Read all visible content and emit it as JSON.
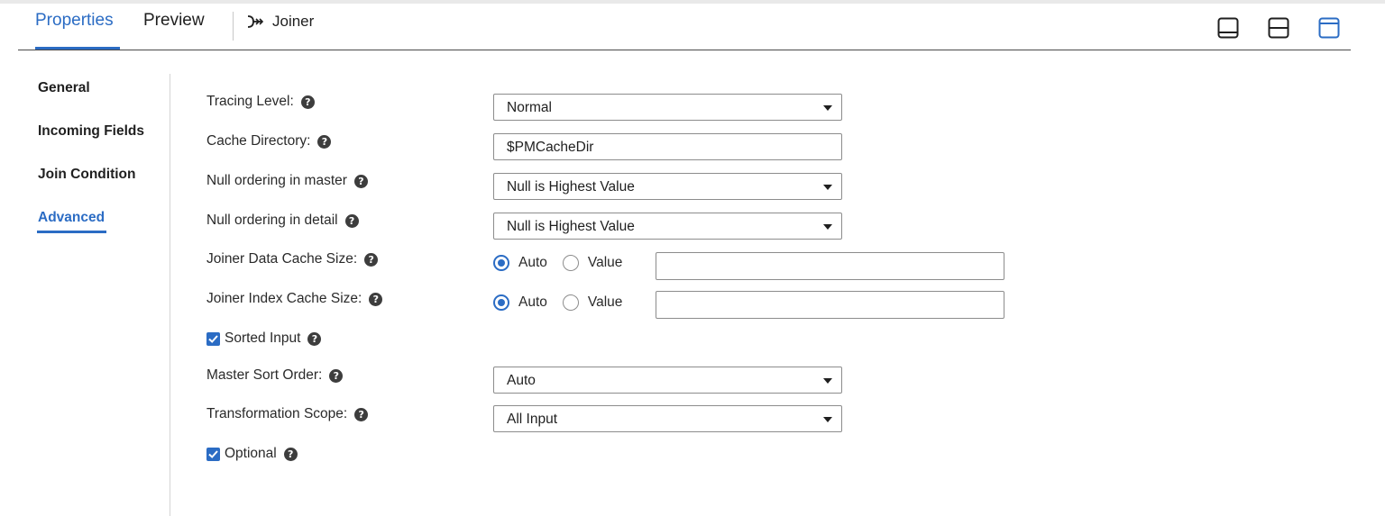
{
  "header": {
    "tabs": [
      {
        "label": "Properties",
        "active": true
      },
      {
        "label": "Preview",
        "active": false
      }
    ],
    "title": "Joiner",
    "title_icon": "joiner-icon",
    "layout_buttons": [
      "panel-bottom-icon",
      "panel-split-icon",
      "panel-top-icon"
    ]
  },
  "sidebar": {
    "items": [
      {
        "label": "General",
        "active": false
      },
      {
        "label": "Incoming Fields",
        "active": false
      },
      {
        "label": "Join Condition",
        "active": false
      },
      {
        "label": "Advanced",
        "active": true
      }
    ]
  },
  "form": {
    "tracing_level": {
      "label": "Tracing Level:",
      "value": "Normal"
    },
    "cache_directory": {
      "label": "Cache Directory:",
      "value": "$PMCacheDir"
    },
    "null_ordering_master": {
      "label": "Null ordering in master",
      "value": "Null is Highest Value"
    },
    "null_ordering_detail": {
      "label": "Null ordering in detail",
      "value": "Null is Highest Value"
    },
    "data_cache_size": {
      "label": "Joiner Data Cache Size:",
      "option_auto": "Auto",
      "option_value": "Value",
      "selected": "Auto",
      "value": ""
    },
    "index_cache_size": {
      "label": "Joiner Index Cache Size:",
      "option_auto": "Auto",
      "option_value": "Value",
      "selected": "Auto",
      "value": ""
    },
    "sorted_input": {
      "label": "Sorted Input",
      "checked": true
    },
    "master_sort_order": {
      "label": "Master Sort Order:",
      "value": "Auto"
    },
    "transformation_scope": {
      "label": "Transformation Scope:",
      "value": "All Input"
    },
    "optional": {
      "label": "Optional",
      "checked": true
    }
  },
  "colors": {
    "accent": "#2b6cc4",
    "text": "#1f1f1f",
    "help_icon": "#3d3d3d"
  }
}
